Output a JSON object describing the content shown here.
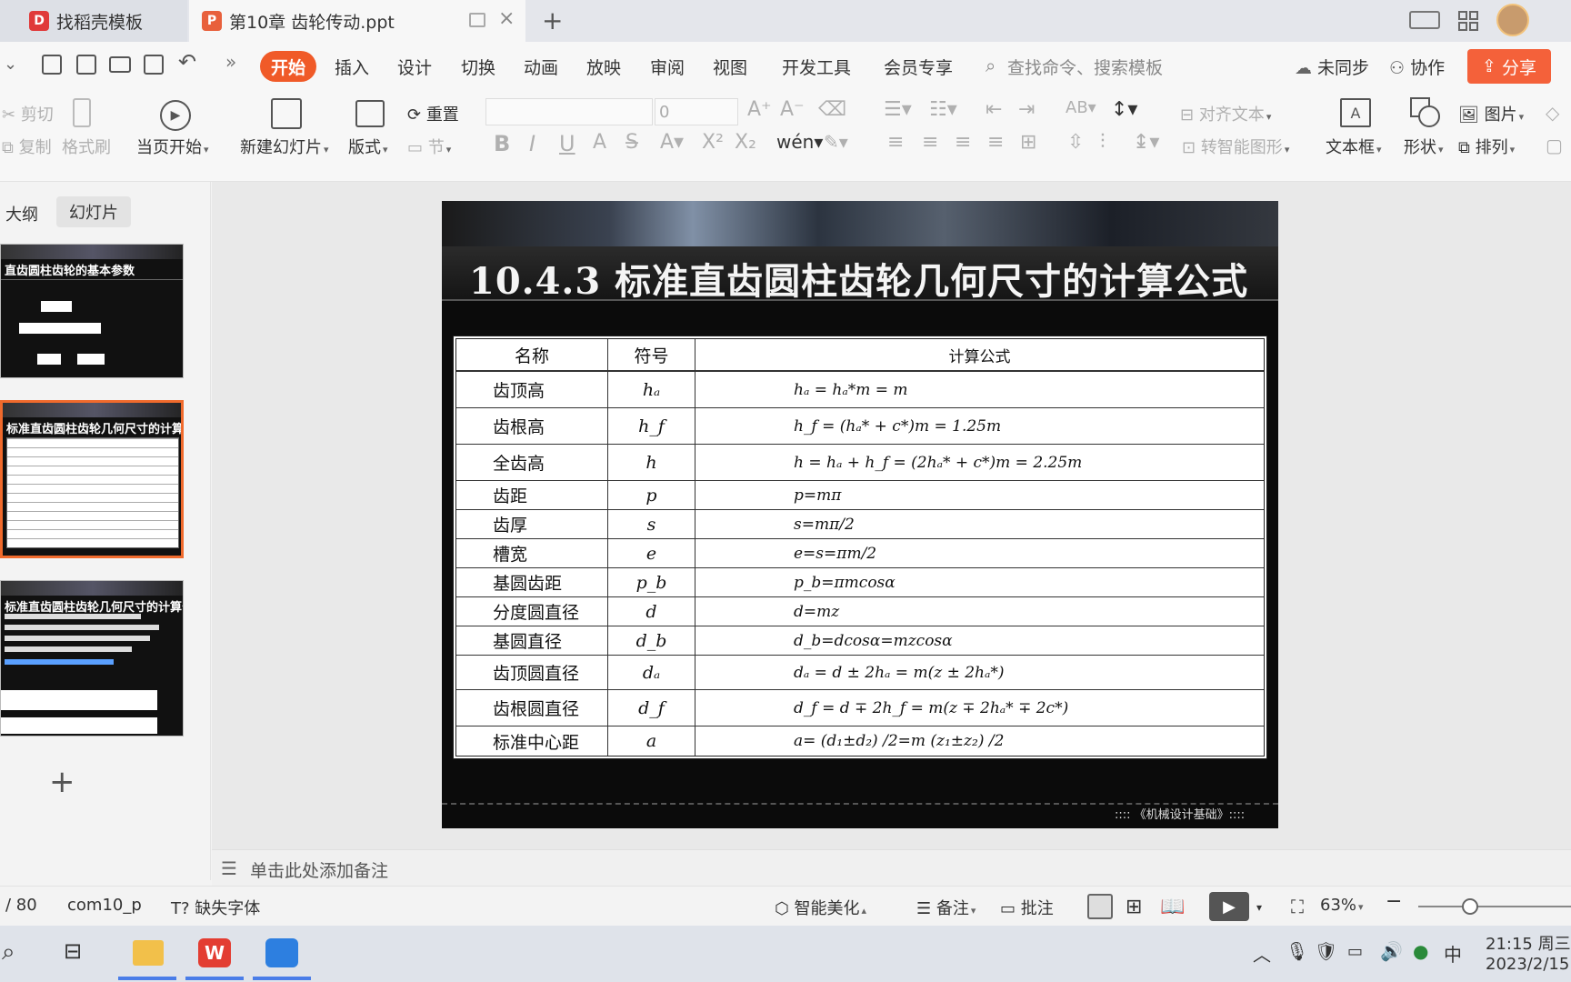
{
  "tabs": [
    {
      "label": "找稻壳模板",
      "active": false
    },
    {
      "label": "第10章 齿轮传动.ppt",
      "active": true
    }
  ],
  "menu": {
    "items": [
      "开始",
      "插入",
      "设计",
      "切换",
      "动画",
      "放映",
      "审阅",
      "视图",
      "开发工具",
      "会员专享"
    ],
    "active": "开始",
    "search_placeholder": "查找命令、搜索模板",
    "sync_label": "未同步",
    "collab_label": "协作",
    "share_label": "分享"
  },
  "ribbon": {
    "cut": "剪切",
    "copy": "复制",
    "format_painter": "格式刷",
    "play_from_current": "当页开始",
    "new_slide": "新建幻灯片",
    "layout": "版式",
    "section": "节",
    "reset": "重置",
    "font_size_value": "0",
    "align_text": "对齐文本",
    "smartart": "转智能图形",
    "textbox": "文本框",
    "shape": "形状",
    "picture": "图片",
    "arrange": "排列"
  },
  "left_panel": {
    "tab_outline": "大纲",
    "tab_slides": "幻灯片",
    "thumb1_title": "直齿圆柱齿轮的基本参数",
    "thumb2_title": "标准直齿圆柱齿轮几何尺寸的计算公式",
    "thumb3_title": "标准直齿圆柱齿轮几何尺寸的计算公式",
    "add_symbol": "+"
  },
  "slide": {
    "title": "10.4.3  标准直齿圆柱齿轮几何尺寸的计算公式",
    "footer": ":::: 《机械设计基础》::::",
    "table": {
      "headers": [
        "名称",
        "符号",
        "计算公式"
      ],
      "rows": [
        {
          "name": "齿顶高",
          "symbol": "hₐ",
          "formula": "hₐ = hₐ*m = m"
        },
        {
          "name": "齿根高",
          "symbol": "h_f",
          "formula": "h_f = (hₐ* + c*)m = 1.25m"
        },
        {
          "name": "全齿高",
          "symbol": "h",
          "formula": "h = hₐ + h_f = (2hₐ* + c*)m = 2.25m"
        },
        {
          "name": "齿距",
          "symbol": "p",
          "formula": "p=mπ"
        },
        {
          "name": "齿厚",
          "symbol": "s",
          "formula": "s=mπ/2"
        },
        {
          "name": "槽宽",
          "symbol": "e",
          "formula": "e=s=πm/2"
        },
        {
          "name": "基圆齿距",
          "symbol": "p_b",
          "formula": "p_b=πmcosα"
        },
        {
          "name": "分度圆直径",
          "symbol": "d",
          "formula": "d=mz"
        },
        {
          "name": "基圆直径",
          "symbol": "d_b",
          "formula": "d_b=dcosα=mzcosα"
        },
        {
          "name": "齿顶圆直径",
          "symbol": "dₐ",
          "formula": "dₐ = d ± 2hₐ = m(z ± 2hₐ*)"
        },
        {
          "name": "齿根圆直径",
          "symbol": "d_f",
          "formula": "d_f = d ∓ 2h_f = m(z ∓ 2hₐ* ∓ 2c*)"
        },
        {
          "name": "标准中心距",
          "symbol": "a",
          "formula": "a= (d₁±d₂) /2=m (z₁±z₂) /2"
        }
      ]
    }
  },
  "notes_placeholder": "单击此处添加备注",
  "status": {
    "page": "/ 80",
    "template": "com10_p",
    "missing_font": "缺失字体",
    "beautify": "智能美化",
    "notes": "备注",
    "comment": "批注",
    "zoom": "63%"
  },
  "taskbar": {
    "ime": "中",
    "time": "21:15 周三",
    "date": "2023/2/15"
  },
  "colors": {
    "accent": "#f05a28",
    "share_bg": "#f4613a",
    "slide_bg": "#0b0b0b"
  }
}
